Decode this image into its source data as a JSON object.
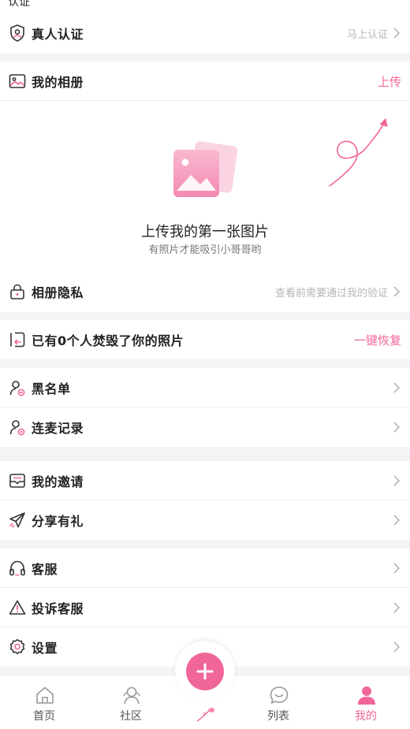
{
  "top_partial": {
    "label": "认证"
  },
  "verify": {
    "label": "真人认证",
    "hint": "马上认证"
  },
  "album": {
    "label": "我的相册",
    "action": "上传",
    "empty_title": "上传我的第一张图片",
    "empty_sub": "有照片才能吸引小哥哥哟"
  },
  "album_privacy": {
    "label": "相册隐私",
    "hint": "查看前需要通过我的验证"
  },
  "destroyed": {
    "label": "已有0个人焚毁了你的照片",
    "action": "一键恢复"
  },
  "blacklist": {
    "label": "黑名单"
  },
  "mic_records": {
    "label": "连麦记录"
  },
  "invite": {
    "label": "我的邀请"
  },
  "share": {
    "label": "分享有礼"
  },
  "service": {
    "label": "客服"
  },
  "complaint": {
    "label": "投诉客服"
  },
  "settings": {
    "label": "设置"
  },
  "tabs": [
    {
      "label": "首页",
      "icon": "home-icon"
    },
    {
      "label": "社区",
      "icon": "community-icon"
    },
    {
      "label": "",
      "icon": "add-icon"
    },
    {
      "label": "列表",
      "icon": "chat-icon"
    },
    {
      "label": "我的",
      "icon": "profile-icon"
    }
  ],
  "colors": {
    "accent": "#f1669a",
    "background": "#f4f4f6",
    "muted": "#b6b6bb"
  }
}
